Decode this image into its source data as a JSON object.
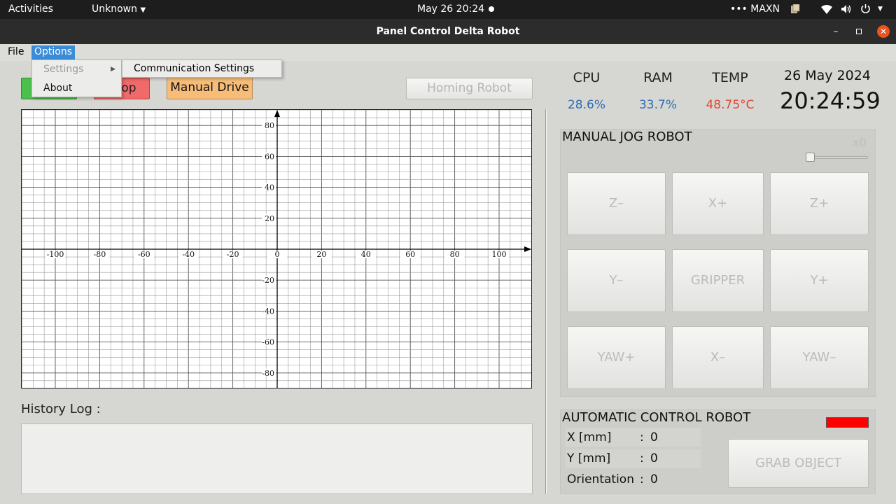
{
  "system_bar": {
    "activities": "Activities",
    "app_menu": "Unknown",
    "datetime": "May 26  20:24",
    "power_mode": "MAXN"
  },
  "window": {
    "title": "Panel Control Delta Robot"
  },
  "menubar": {
    "file": "File",
    "options": "Options"
  },
  "options_menu": {
    "items": [
      "Settings",
      "About"
    ],
    "settings_submenu": [
      "Communication Settings"
    ]
  },
  "toolbar": {
    "stop_label_visible": "op",
    "manual_drive": "Manual Drive",
    "homing": "Homing Robot",
    "colors": {
      "start": "#4cc04c",
      "stop": "#f06a6a",
      "manual_drive": "#f7bd78"
    }
  },
  "plot": {
    "x_ticks": [
      "-100",
      "-80",
      "-60",
      "-40",
      "-20",
      "0",
      "20",
      "40",
      "60",
      "80",
      "100"
    ],
    "y_ticks": [
      "80",
      "60",
      "40",
      "20",
      "-20",
      "-40",
      "-60",
      "-80"
    ],
    "x_range": [
      -115,
      115
    ],
    "y_range": [
      -90,
      90
    ],
    "grid": true
  },
  "history": {
    "label": "History Log :"
  },
  "stats": {
    "cpu": {
      "label": "CPU",
      "value": "28.6%",
      "color": "#2e6db0"
    },
    "ram": {
      "label": "RAM",
      "value": "33.7%",
      "color": "#2e6db0"
    },
    "temp": {
      "label": "TEMP",
      "value": "48.75°C",
      "color": "#e4462e"
    },
    "date": "26 May 2024",
    "time": "20:24:59"
  },
  "jog": {
    "title": "MANUAL JOG ROBOT",
    "speed_label": "x0",
    "slider_value": 0,
    "buttons": [
      "Z–",
      "X+",
      "Z+",
      "Y–",
      "GRIPPER",
      "Y+",
      "YAW+",
      "X–",
      "YAW–"
    ]
  },
  "auto": {
    "title": "AUTOMATIC CONTROL ROBOT",
    "status_color": "#ff0000",
    "rows": [
      {
        "label": "X [mm]",
        "sep": ":",
        "value": "0"
      },
      {
        "label": "Y [mm]",
        "sep": ":",
        "value": "0"
      },
      {
        "label": "Orientation",
        "sep": ":",
        "value": "0"
      }
    ],
    "grab": "GRAB OBJECT"
  }
}
